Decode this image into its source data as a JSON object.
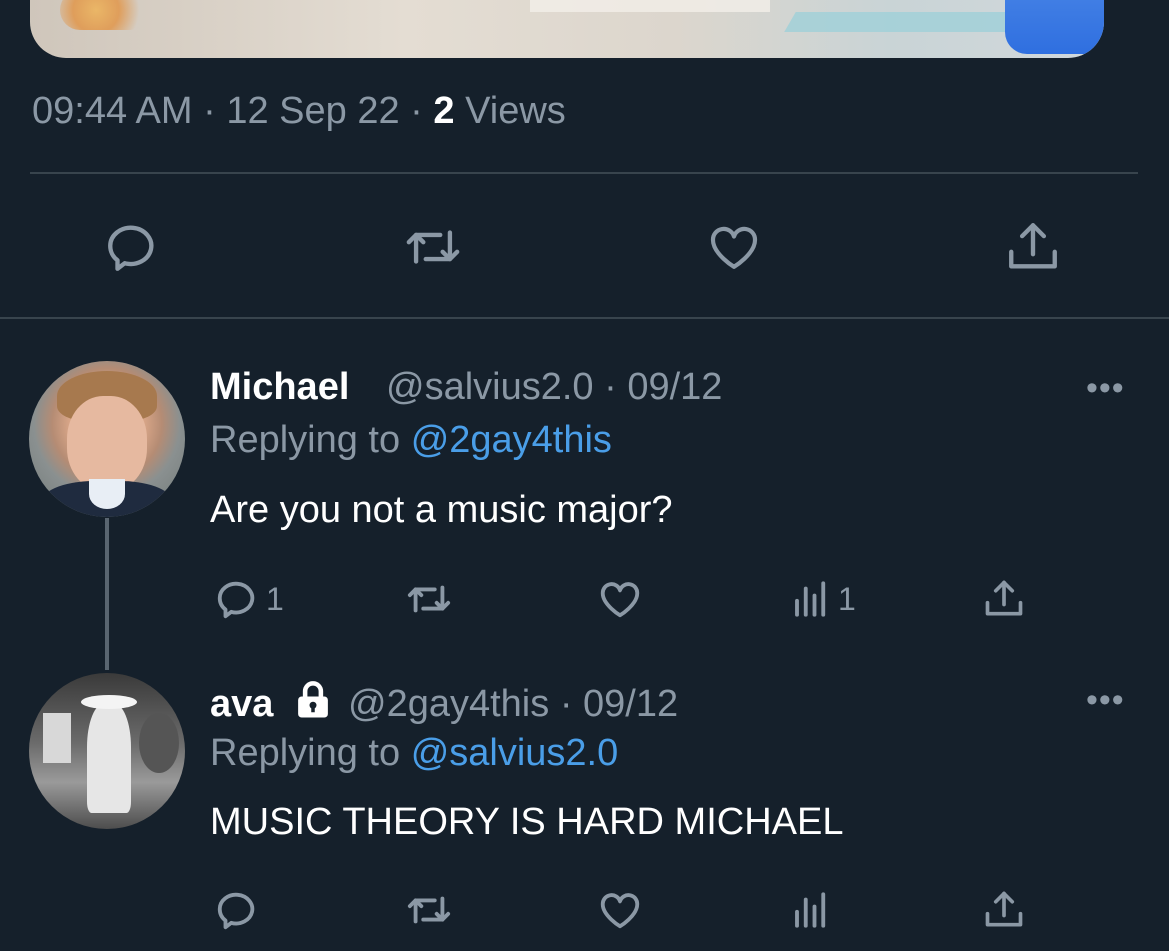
{
  "tweet": {
    "time": "09:44 AM",
    "dot": "·",
    "date": "12 Sep 22",
    "views_count": "2",
    "views_label": "Views"
  },
  "icons": {
    "reply": "reply-icon",
    "retweet": "retweet-icon",
    "like": "heart-icon",
    "share": "share-icon",
    "views": "views-icon",
    "more": "more-icon",
    "lock": "lock-icon"
  },
  "colors": {
    "background": "#15202b",
    "secondary_text": "#8b98a5",
    "link": "#4a9ee8",
    "divider": "#38444d"
  },
  "replies": [
    {
      "name": "Michael",
      "handle": "@salvius2.0",
      "dot": "·",
      "date": "09/12",
      "replying_label": "Replying to",
      "replying_to": "@2gay4this",
      "text": "Are you not a music major?",
      "reply_count": "1",
      "views_count": "1",
      "more": "•••"
    },
    {
      "name": "ava",
      "handle": "@2gay4this",
      "dot": "·",
      "date": "09/12",
      "replying_label": "Replying to",
      "replying_to": "@salvius2.0",
      "text": "MUSIC THEORY IS HARD MICHAEL",
      "more": "•••"
    }
  ]
}
